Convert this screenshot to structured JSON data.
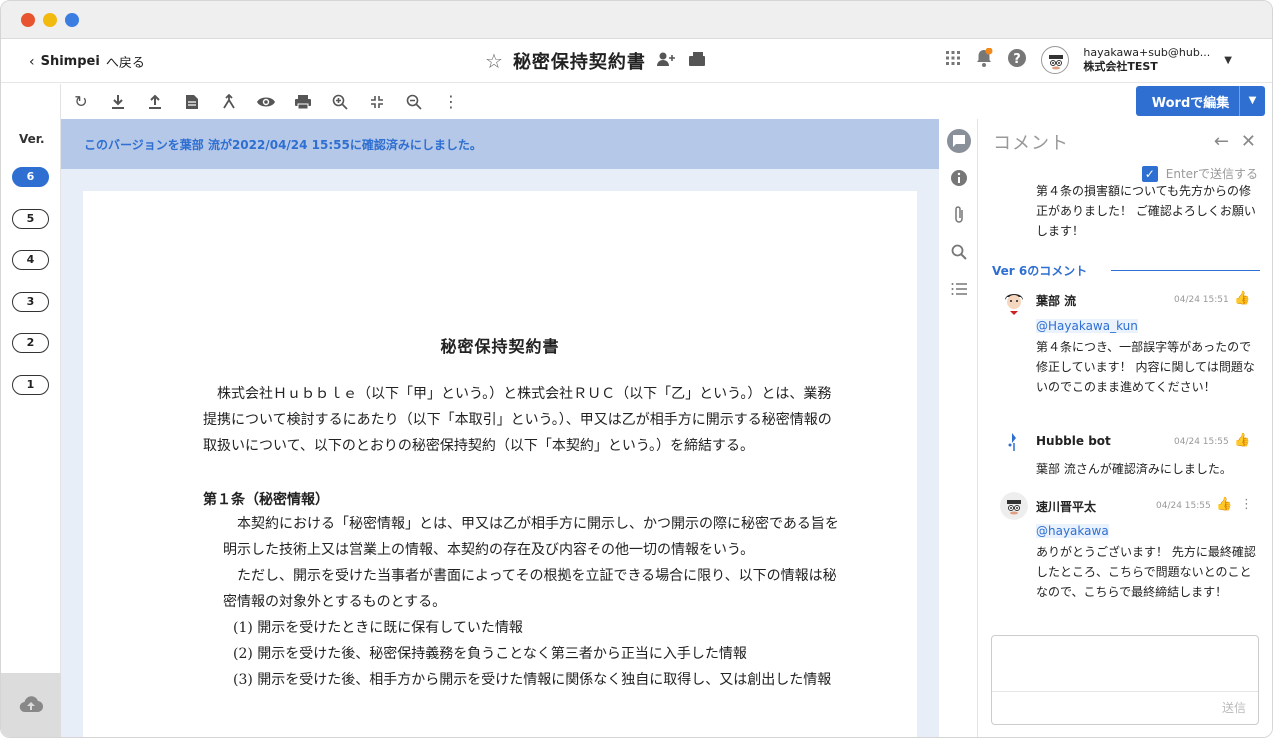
{
  "header": {
    "back_user": "Shimpei",
    "back_label": "へ戻る",
    "doc_title": "秘密保持契約書",
    "user_email": "hayakawa+sub@hub...",
    "user_company": "株式会社TEST"
  },
  "toolbar": {
    "word_edit_label": "Wordで編集"
  },
  "versions": {
    "label": "Ver.",
    "items": [
      "6",
      "5",
      "4",
      "3",
      "2",
      "1"
    ],
    "active": "6"
  },
  "banner": "このバージョンを葉部 流が2022/04/24 15:55に確認済みにしました。",
  "document": {
    "title": "秘密保持契約書",
    "intro": "株式会社Ｈｕｂｂｌｅ（以下「甲」という。）と株式会社ＲＵＣ（以下「乙」という。）とは、業務提携について検討するにあたり（以下「本取引」という。）、甲又は乙が相手方に開示する秘密情報の取扱いについて、以下のとおりの秘密保持契約（以下「本契約」という。）を締結する。",
    "article1_title": "第１条（秘密情報）",
    "article1_p1": "本契約における「秘密情報」とは、甲又は乙が相手方に開示し、かつ開示の際に秘密である旨を明示した技術上又は営業上の情報、本契約の存在及び内容その他一切の情報をいう。",
    "article1_p2": "ただし、開示を受けた当事者が書面によってその根拠を立証できる場合に限り、以下の情報は秘密情報の対象外とするものとする。",
    "items": [
      "(1)  開示を受けたときに既に保有していた情報",
      "(2)  開示を受けた後、秘密保持義務を負うことなく第三者から正当に入手した情報",
      "(3)  開示を受けた後、相手方から開示を受けた情報に関係なく独自に取得し、又は創出した情報"
    ]
  },
  "comments": {
    "title": "コメント",
    "enter_to_send": "Enterで送信する",
    "previous_message": "第４条の損害額についても先方からの修正がありました！ ご確認よろしくお願いします！",
    "version_header": "Ver 6のコメント",
    "thread": [
      {
        "author": "葉部 流",
        "time": "04/24 15:51",
        "mention": "@Hayakawa_kun",
        "body": "第４条につき、一部誤字等があったので修正しています！ 内容に関しては問題ないのでこのまま進めてください！"
      },
      {
        "author": "Hubble bot",
        "time": "04/24 15:55",
        "mention": "",
        "body": "葉部 流さんが確認済みにしました。"
      },
      {
        "author": "速川晋平太",
        "time": "04/24 15:55",
        "mention": "@hayakawa",
        "body": "ありがとうございます！ 先方に最終確認したところ、こちらで問題ないとのことなので、こちらで最終締結します！"
      }
    ],
    "send_label": "送信"
  },
  "colors": {
    "accent": "#2f6fd1",
    "banner_bg": "#b5c8e8",
    "doc_bg": "#e8eef7",
    "traffic_red": "#e8542f",
    "traffic_yellow": "#f2b90f",
    "traffic_blue": "#3b7de0"
  },
  "icons": [
    "refresh-icon",
    "download-icon",
    "upload-icon",
    "document-icon",
    "merge-icon",
    "eye-icon",
    "print-icon",
    "zoom-in-icon",
    "fit-icon",
    "zoom-out-icon",
    "more-vertical-icon",
    "star-icon",
    "share-user-icon",
    "folder-icon",
    "apps-grid-icon",
    "bell-icon",
    "help-icon",
    "comment-icon",
    "info-icon",
    "attachment-icon",
    "search-icon",
    "list-icon",
    "cloud-upload-icon",
    "thumbs-up-icon",
    "close-icon",
    "arrow-left-icon"
  ]
}
